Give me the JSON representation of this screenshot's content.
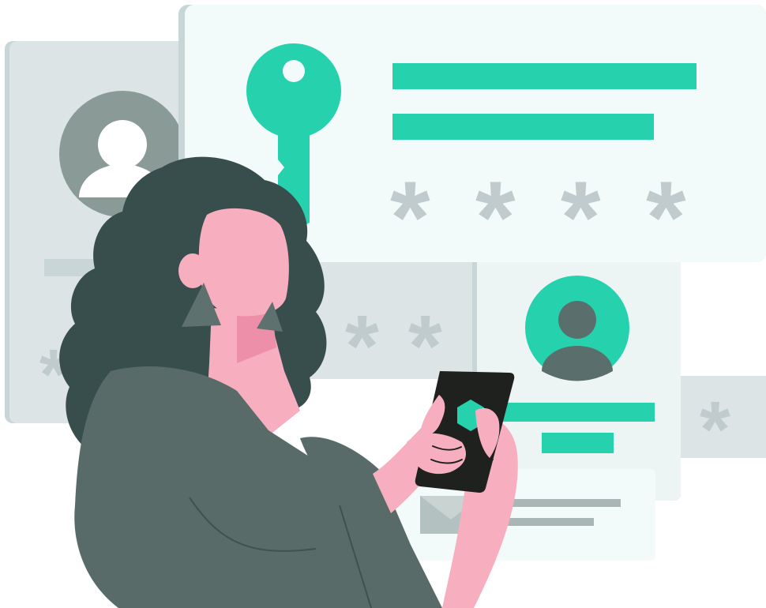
{
  "scene": {
    "type": "illustration",
    "subject": "woman-using-phone-login-security",
    "password_mask": "*",
    "masked_password_main": [
      "*",
      "*",
      "*",
      "*"
    ],
    "masked_password_back": [
      "*",
      "*",
      "*"
    ],
    "masked_password_side": [
      "*"
    ]
  },
  "colors": {
    "accent": "#26D1AE",
    "panel_light": "#F3FAFA",
    "panel_grey": "#DDE4E5",
    "panel_border": "#C9D6D7",
    "asterisk": "#BFCBCC",
    "hair": "#374E4D",
    "shirt": "#586B68",
    "skin": "#F7AFC0",
    "phone": "#1F211F",
    "avatar_dark": "#5A6E6B",
    "avatar_grey": "#8A9A97"
  },
  "icons": {
    "key": "key-icon",
    "user_avatar": "user-avatar-icon",
    "envelope": "envelope-icon",
    "shield": "hexagon-shield-icon"
  }
}
